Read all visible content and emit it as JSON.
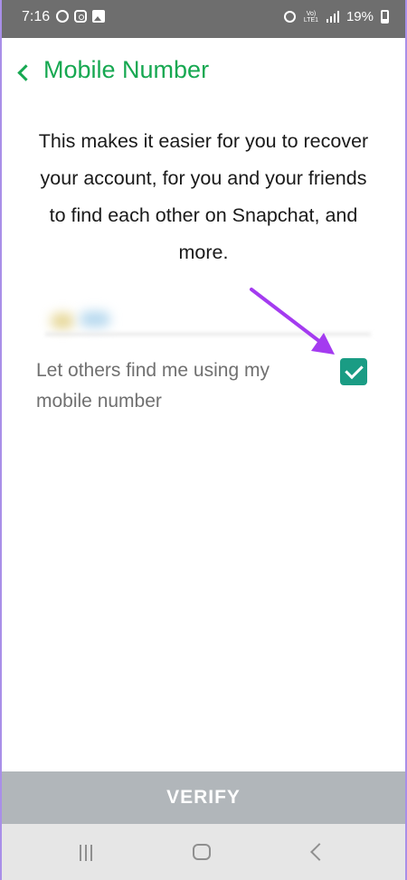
{
  "status_bar": {
    "time": "7:16",
    "left_icons": [
      "whatsapp-icon",
      "instagram-icon",
      "gallery-icon"
    ],
    "right_icons": [
      "alarm-icon",
      "volte-icon",
      "signal-icon",
      "battery-icon"
    ],
    "volte_text": "Vo) LTE1",
    "battery_percent": "19%"
  },
  "header": {
    "back_icon": "chevron-left-icon",
    "title": "Mobile Number"
  },
  "description": "This makes it easier for you to recover your account, for you and your friends to find each other on Snapchat, and more.",
  "setting": {
    "label": "Let others find me using my mobile number",
    "checked": true
  },
  "verify_button": {
    "label": "VERIFY"
  },
  "nav_bar": {
    "icons": [
      "recent-apps-icon",
      "home-icon",
      "back-icon"
    ]
  },
  "colors": {
    "accent_green": "#16a851",
    "checkbox_teal": "#1a9c84",
    "arrow_purple": "#a43bf0",
    "status_bar": "#6e6e6e",
    "verify_bar": "#b1b6ba",
    "nav_bar": "#e6e6e6"
  }
}
